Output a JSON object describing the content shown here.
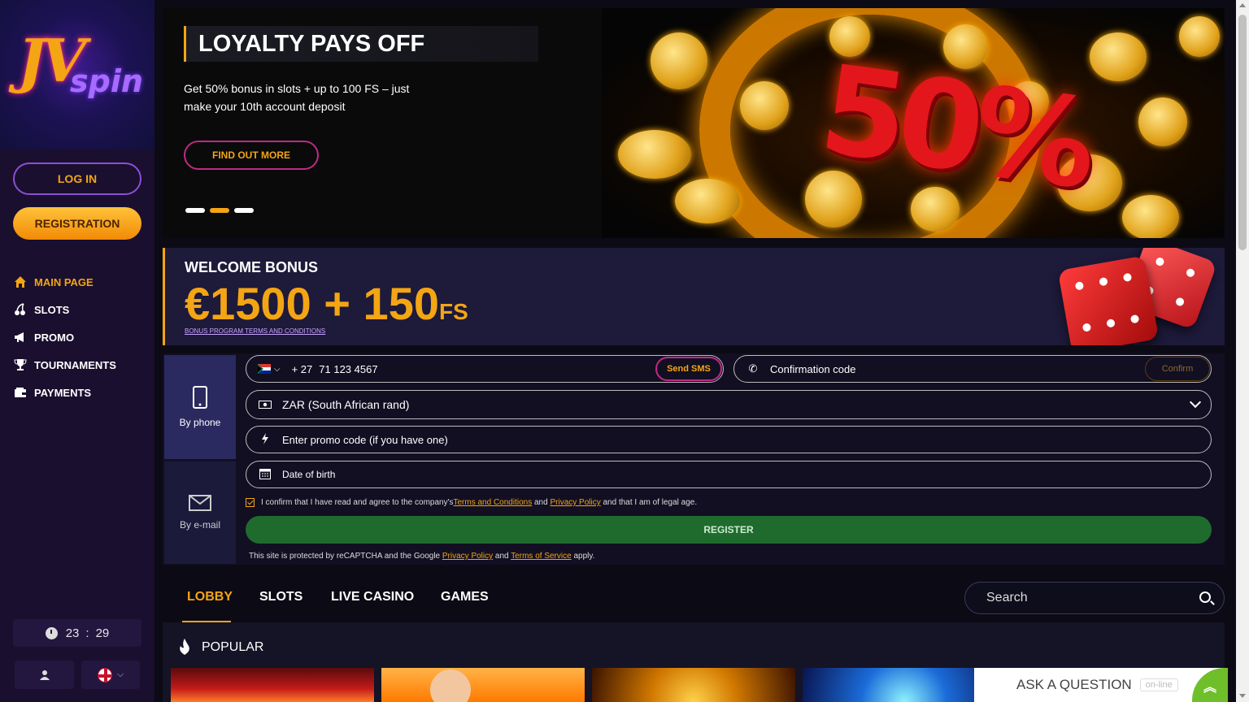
{
  "brand": {
    "logo_jv": "JV",
    "logo_spin": "spin"
  },
  "sidebar": {
    "login_label": "LOG IN",
    "registration_label": "REGISTRATION",
    "items": [
      {
        "label": "MAIN PAGE",
        "icon": "home-icon",
        "active": true
      },
      {
        "label": "SLOTS",
        "icon": "cherries-icon"
      },
      {
        "label": "PROMO",
        "icon": "megaphone-icon"
      },
      {
        "label": "TOURNAMENTS",
        "icon": "trophy-icon"
      },
      {
        "label": "PAYMENTS",
        "icon": "wallet-icon"
      }
    ],
    "clock": {
      "hours": "23",
      "sep": ":",
      "minutes": "29"
    },
    "language": "en"
  },
  "banner": {
    "title": "LOYALTY PAYS OFF",
    "subtitle": "Get 50% bonus in slots + up to 100 FS – just make your 10th account deposit",
    "button_label": "FIND OUT MORE",
    "big_text": "50%",
    "slides": 3,
    "active_slide": 2
  },
  "bonus": {
    "label": "WELCOME BONUS",
    "amount": "€1500 + 150",
    "amount_suffix": "FS",
    "terms": "BONUS PROGRAM TERMS AND CONDITIONS"
  },
  "registration": {
    "tabs": [
      {
        "label": "By phone",
        "active": true
      },
      {
        "label": "By e-mail",
        "active": false
      }
    ],
    "phone": {
      "flag": "ZA",
      "code": "+ 27",
      "value": "71 123 4567",
      "send_label": "Send SMS"
    },
    "confirmation": {
      "placeholder": "Confirmation code",
      "button_label": "Confirm"
    },
    "currency": "ZAR (South African rand)",
    "promo_placeholder": "Enter promo code (if you have one)",
    "dob_placeholder": "Date of birth",
    "agree": {
      "text1": "I confirm that I have read and agree to the company's ",
      "terms_link": "Terms and Conditions",
      "text2": " and ",
      "privacy_link": "Privacy Policy",
      "text3": " and that I am of legal age.",
      "checked": true
    },
    "register_label": "REGISTER",
    "recaptcha": {
      "text1": "This site is protected by reCAPTCHA and the Google ",
      "privacy_link": "Privacy Policy",
      "text2": " and ",
      "tos_link": "Terms of Service",
      "text3": " apply."
    }
  },
  "lobby": {
    "tabs": [
      "LOBBY",
      "SLOTS",
      "LIVE CASINO",
      "GAMES"
    ],
    "active_tab": 0,
    "search_placeholder": "Search"
  },
  "popular": {
    "title": "POPULAR"
  },
  "chat": {
    "label": "ASK A QUESTION",
    "status": "on-line"
  },
  "colors": {
    "accent": "#f4a514",
    "sidebar_bg": "#1a0f2e",
    "register_green": "#1f6b2e",
    "pink_border": "#c02a86"
  }
}
